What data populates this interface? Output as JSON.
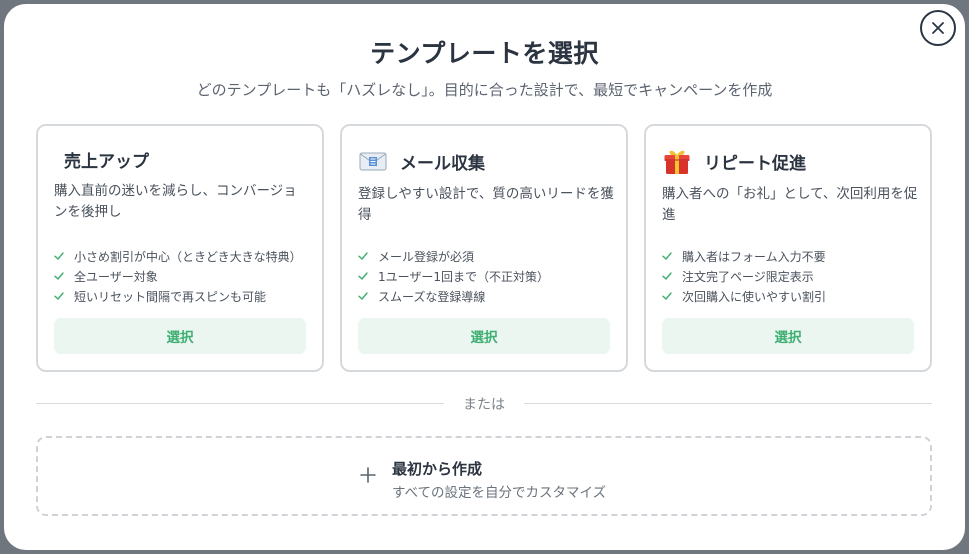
{
  "modal": {
    "title": "テンプレートを選択",
    "subtitle": "どのテンプレートも「ハズレなし」。目的に合った設計で、最短でキャンペーンを作成",
    "close_icon": "close-icon"
  },
  "cards": [
    {
      "icon": "",
      "title": "売上アップ",
      "description": "購入直前の迷いを減らし、コンバージョンを後押し",
      "features": [
        "小さめ割引が中心（ときどき大きな特典）",
        "全ユーザー対象",
        "短いリセット間隔で再スピンも可能"
      ],
      "select_label": "選択"
    },
    {
      "icon": "envelope-icon",
      "title": "メール収集",
      "description": "登録しやすい設計で、質の高いリードを獲得",
      "features": [
        "メール登録が必須",
        "1ユーザー1回まで（不正対策）",
        "スムーズな登録導線"
      ],
      "select_label": "選択"
    },
    {
      "icon": "gift-icon",
      "title": "リピート促進",
      "description": "購入者への「お礼」として、次回利用を促進",
      "features": [
        "購入者はフォーム入力不要",
        "注文完了ページ限定表示",
        "次回購入に使いやすい割引"
      ],
      "select_label": "選択"
    }
  ],
  "divider": {
    "label": "または"
  },
  "custom": {
    "icon": "plus-icon",
    "title": "最初から作成",
    "subtitle": "すべての設定を自分でカスタマイズ"
  },
  "colors": {
    "accent_green": "#3fae73",
    "button_bg": "#eaf6ef",
    "text_dark": "#2b3440",
    "border": "#d6d9dc"
  }
}
